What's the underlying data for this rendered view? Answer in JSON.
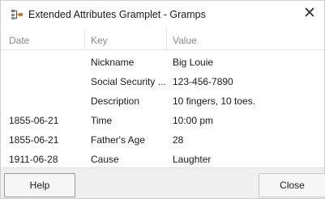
{
  "window": {
    "title": "Extended Attributes Gramplet - Gramps",
    "close_glyph": "✕",
    "icon": "gramps-app-icon"
  },
  "columns": {
    "date": "Date",
    "key": "Key",
    "value": "Value"
  },
  "rows": [
    {
      "date": "",
      "key": "Nickname",
      "value": "Big Louie"
    },
    {
      "date": "",
      "key": "Social Security ...",
      "value": "123-456-7890"
    },
    {
      "date": "",
      "key": "Description",
      "value": "10 fingers, 10 toes."
    },
    {
      "date": "1855-06-21",
      "key": "Time",
      "value": "10:00 pm"
    },
    {
      "date": "1855-06-21",
      "key": "Father's Age",
      "value": "28"
    },
    {
      "date": "1911-06-28",
      "key": "Cause",
      "value": "Laughter"
    }
  ],
  "footer": {
    "help_label": "Help",
    "close_label": "Close"
  }
}
